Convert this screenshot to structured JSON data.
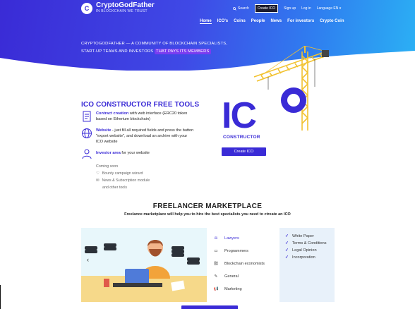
{
  "brand": {
    "name": "CryptoGodFather",
    "tagline": "IN BLOCKCHAIN WE TRUST",
    "mark": "C"
  },
  "topbar": {
    "search": "Search",
    "create": "Create ICO",
    "signup": "Sign up",
    "login": "Log in",
    "language": "Language EN"
  },
  "nav": [
    "Home",
    "ICO's",
    "Coins",
    "People",
    "News",
    "For investors",
    "Crypto Coin"
  ],
  "hero": {
    "line1": "CRYPTOGODFATHER — A COMMUNITY OF BLOCKCHAIN SPECIALISTS,",
    "line2_prefix": "START-UP TEAMS AND INVESTORS",
    "line2_highlight": "THAT PAYS ITS MEMBERS"
  },
  "ico": {
    "big": "IC",
    "constructor": "CONSTRUCTOR",
    "button": "Create ICO"
  },
  "tools": {
    "title": "ICO CONSTRUCTOR FREE TOOLS",
    "items": [
      {
        "link": "Contract creation",
        "text": " with web interface (ERC20 token based on Etherium blockchain)"
      },
      {
        "link": "Website",
        "text": " - just fill all required fields and press the button \"export website\", and download an archive with your ICO website"
      },
      {
        "link": "Investor area",
        "text": " for your website"
      }
    ],
    "coming_soon": "Coming soon",
    "soon_items": [
      "Bounty campaign wizard",
      "News & Subscription module",
      "and other tools"
    ]
  },
  "freelancer": {
    "title": "FREELANCER MARKETPLACE",
    "subtitle": "Freelance marketplace will help you to hire the best specialists you need to ctreate an ICO",
    "categories": [
      "Lawyers",
      "Programmers",
      "Blockchain economists",
      "General",
      "Marketing"
    ],
    "checks": [
      "White Paper",
      "Terms & Conditions",
      "Legal Opinion",
      "Incorporation"
    ],
    "prev": "‹",
    "next": "›"
  },
  "colors": {
    "accent": "#3a2bd6",
    "crane": "#f2c230"
  }
}
